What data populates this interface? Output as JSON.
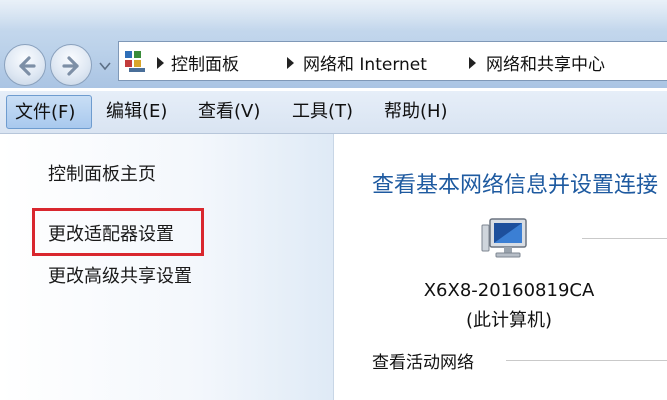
{
  "address_bar": {
    "crumbs": [
      "控制面板",
      "网络和 Internet",
      "网络和共享中心"
    ]
  },
  "menu": {
    "items": [
      "文件(F)",
      "编辑(E)",
      "查看(V)",
      "工具(T)",
      "帮助(H)"
    ],
    "active_index": 0
  },
  "sidebar": {
    "links": [
      "控制面板主页",
      "更改适配器设置",
      "更改高级共享设置"
    ]
  },
  "main": {
    "title": "查看基本网络信息并设置连接",
    "computer_name": "X6X8-20160819CA",
    "computer_subtitle": "(此计算机)",
    "active_networks_label": "查看活动网络"
  },
  "colors": {
    "title_blue": "#1e5aa0",
    "highlight_red": "#d9272e",
    "menu_active": "#a9c9ee"
  },
  "icons": [
    "back-arrow-icon",
    "forward-arrow-icon",
    "recent-pages-chevron-icon",
    "control-panel-icon",
    "breadcrumb-separator-icon",
    "computer-monitor-icon"
  ]
}
